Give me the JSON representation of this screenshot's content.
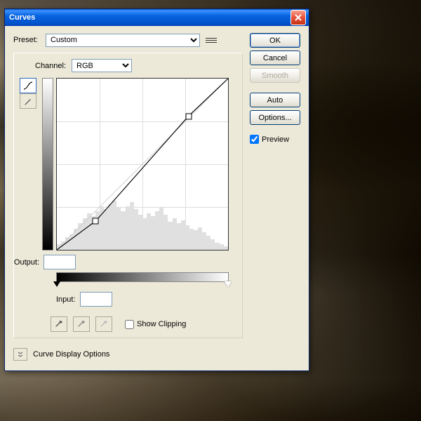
{
  "dialog": {
    "title": "Curves",
    "preset_label": "Preset:",
    "preset_value": "Custom",
    "channel_label": "Channel:",
    "channel_value": "RGB",
    "output_label": "Output:",
    "output_value": "",
    "input_label": "Input:",
    "input_value": "",
    "show_clipping": "Show Clipping",
    "curve_display": "Curve Display Options"
  },
  "buttons": {
    "ok": "OK",
    "cancel": "Cancel",
    "smooth": "Smooth",
    "auto": "Auto",
    "options": "Options..."
  },
  "preview_label": "Preview",
  "preview_checked": true,
  "chart_data": {
    "type": "line",
    "title": "Curves",
    "xlabel": "Input",
    "ylabel": "Output",
    "xlim": [
      0,
      255
    ],
    "ylim": [
      0,
      255
    ],
    "series": [
      {
        "name": "RGB",
        "points": [
          [
            0,
            0
          ],
          [
            58,
            43
          ],
          [
            196,
            199
          ],
          [
            255,
            255
          ]
        ]
      }
    ],
    "control_points": [
      [
        58,
        43
      ],
      [
        196,
        199
      ]
    ],
    "histogram": [
      8,
      12,
      18,
      22,
      30,
      38,
      45,
      52,
      48,
      55,
      62,
      58,
      65,
      70,
      60,
      55,
      62,
      68,
      58,
      50,
      45,
      52,
      48,
      55,
      60,
      50,
      40,
      45,
      38,
      42,
      35,
      30,
      28,
      32,
      25,
      20,
      15,
      10,
      8,
      5
    ]
  }
}
